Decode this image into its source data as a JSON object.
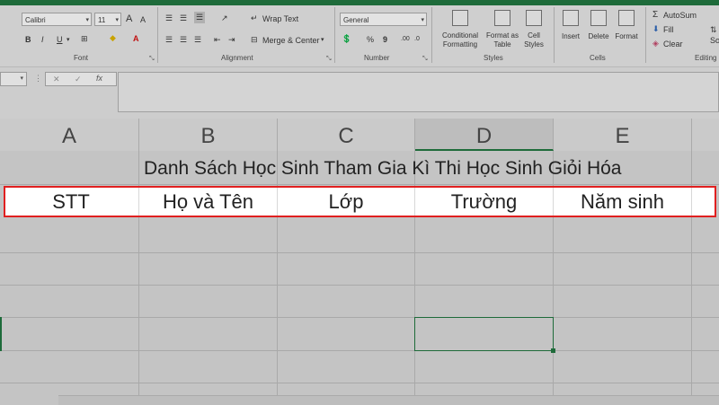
{
  "ribbon": {
    "font": {
      "family": "Calibri",
      "size": "11",
      "group_label": "Font",
      "bold": "B",
      "italic": "I",
      "underline": "U",
      "grow": "A",
      "shrink": "A",
      "font_color": "A"
    },
    "alignment": {
      "wrap_text": "Wrap Text",
      "merge_center": "Merge & Center",
      "group_label": "Alignment"
    },
    "number": {
      "format": "General",
      "percent": "%",
      "comma": "9",
      "group_label": "Number"
    },
    "styles": {
      "conditional": "Conditional",
      "formatting": "Formatting",
      "format_as": "Format as",
      "table": "Table",
      "cell": "Cell",
      "styles_label": "Styles",
      "group_label": "Styles"
    },
    "cells": {
      "insert": "Insert",
      "delete": "Delete",
      "format": "Format",
      "group_label": "Cells"
    },
    "editing": {
      "autosum": "AutoSum",
      "fill": "Fill",
      "clear": "Clear",
      "group_label": "Editing",
      "so": "So"
    }
  },
  "formula_bar": {
    "cancel": "✕",
    "enter": "✓",
    "fx": "fx",
    "value": ""
  },
  "columns": [
    "A",
    "B",
    "C",
    "D",
    "E"
  ],
  "sheet": {
    "title": "Danh Sách Học Sinh Tham Gia Kì Thi Học Sinh Giỏi Hóa",
    "headers": [
      "STT",
      "Họ và Tên",
      "Lớp",
      "Trường",
      "Năm sinh"
    ]
  },
  "colors": {
    "excel_green": "#1e6b3a",
    "highlight_red": "#e02020"
  }
}
